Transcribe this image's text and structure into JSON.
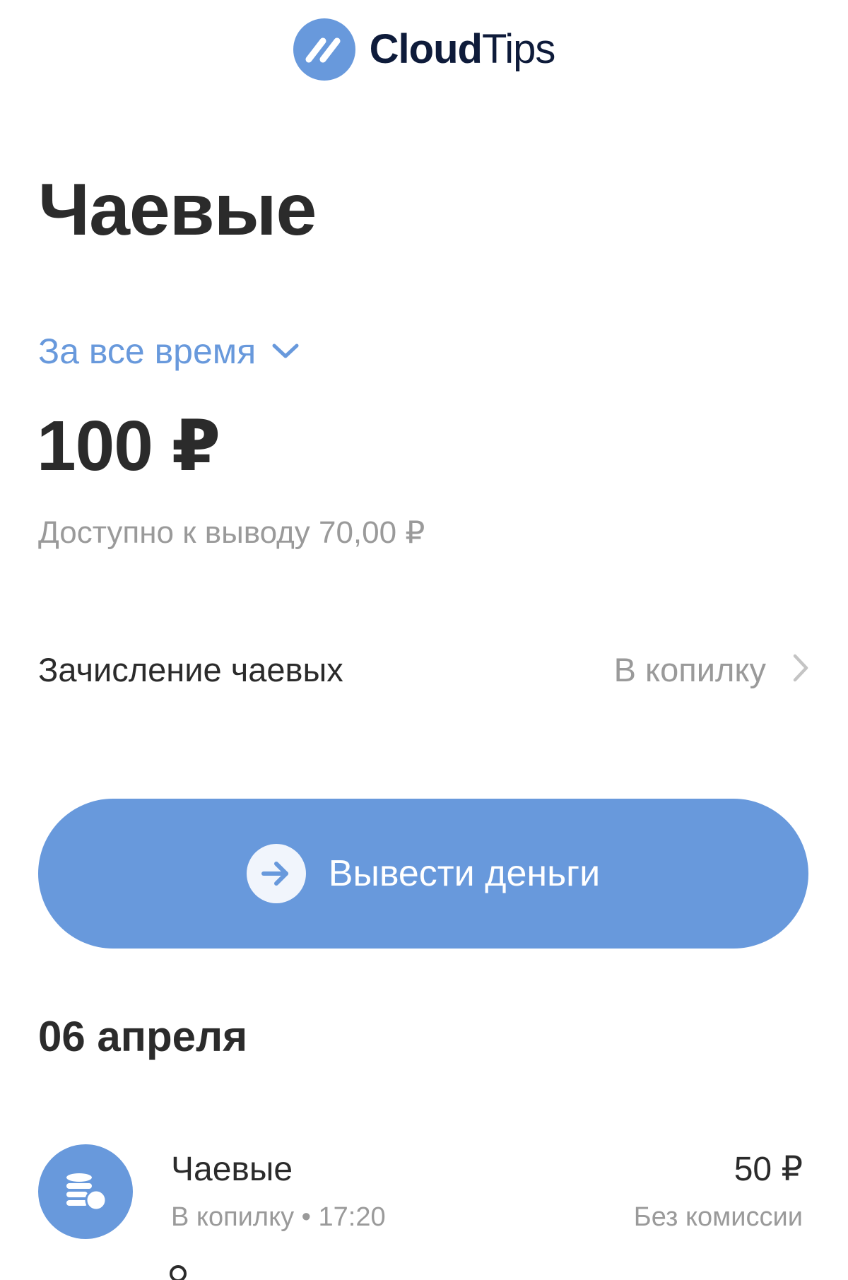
{
  "brand": {
    "name_strong": "Cloud",
    "name_light": "Tips",
    "accent": "#6899dc",
    "text_dark": "#0e1b3a"
  },
  "page": {
    "title": "Чаевые"
  },
  "period": {
    "label": "За все время",
    "icon": "chevron-down-icon"
  },
  "balance": {
    "total": "100 ₽",
    "available": "Доступно к выводу 70,00 ₽"
  },
  "accrual": {
    "label": "Зачисление чаевых",
    "value": "В копилку",
    "icon": "chevron-right-icon"
  },
  "withdraw": {
    "label": "Вывести деньги",
    "icon": "arrow-right-icon"
  },
  "history": {
    "groups": [
      {
        "date": "06 апреля",
        "items": [
          {
            "title": "Чаевые",
            "subtitle": "В копилку • 17:20",
            "amount": "50 ₽",
            "fee": "Без комиссии",
            "icon": "coins-icon"
          }
        ]
      }
    ]
  },
  "colors": {
    "accent": "#6899dc",
    "text": "#2b2b2b",
    "muted": "#9a9a9a",
    "button_text": "#ffffff"
  }
}
